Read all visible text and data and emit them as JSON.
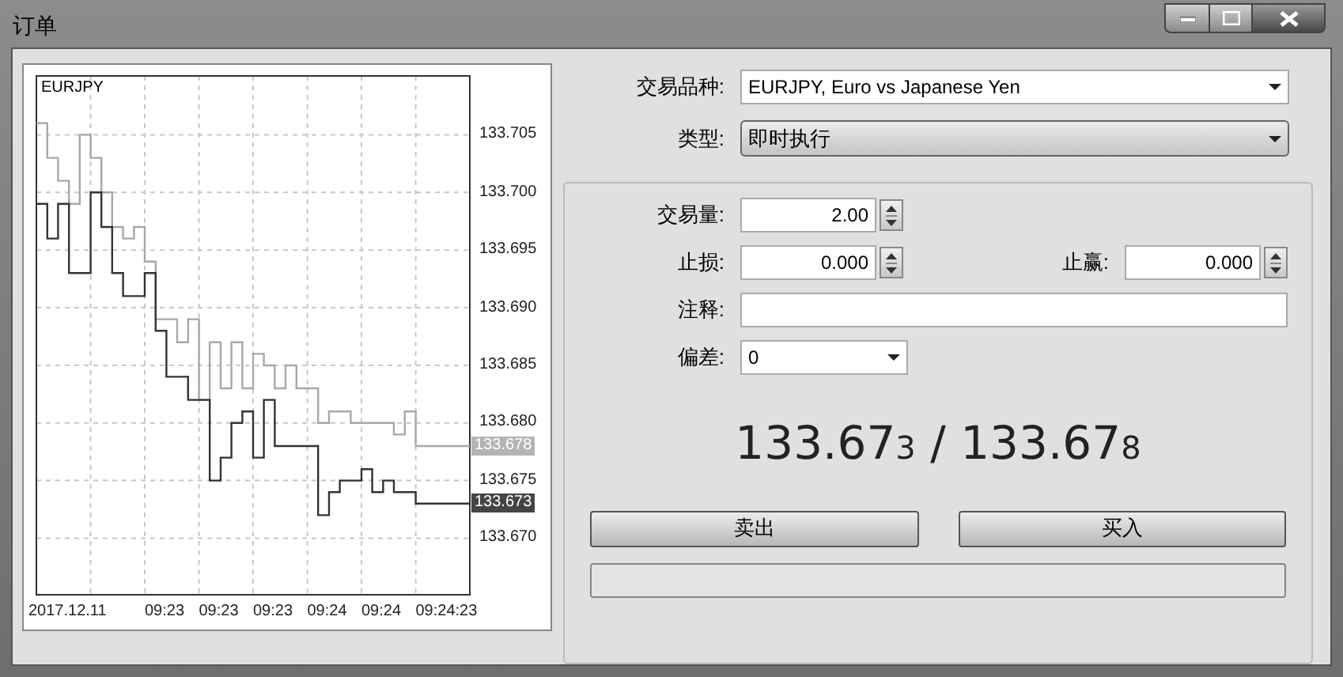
{
  "window": {
    "title": "订单"
  },
  "chart": {
    "symbol": "EURJPY",
    "price_tags": [
      {
        "text": "133.678",
        "kind": "ask"
      },
      {
        "text": "133.673",
        "kind": "bid"
      }
    ],
    "y_axis_labels": [
      "133.705",
      "133.700",
      "133.695",
      "133.690",
      "133.685",
      "133.680",
      "133.675",
      "133.670"
    ],
    "x_axis_labels": [
      "2017.12.11",
      "09:23",
      "09:23",
      "09:23",
      "09:24",
      "09:24",
      "09:24:23"
    ]
  },
  "symbol": {
    "label": "交易品种:",
    "value": "EURJPY, Euro vs Japanese Yen"
  },
  "type": {
    "label": "类型:",
    "value": "即时执行"
  },
  "volume": {
    "label": "交易量:",
    "value": "2.00"
  },
  "stop_loss": {
    "label": "止损:",
    "value": "0.000"
  },
  "take_profit": {
    "label": "止赢:",
    "value": "0.000"
  },
  "comment": {
    "label": "注释:"
  },
  "deviation": {
    "label": "偏差:",
    "value": "0"
  },
  "quote": {
    "bid_main": "133.67",
    "bid_last": "3",
    "separator": "/",
    "ask_main": "133.67",
    "ask_last": "8"
  },
  "buttons": [
    {
      "label": "卖出"
    },
    {
      "label": "买入"
    }
  ]
}
